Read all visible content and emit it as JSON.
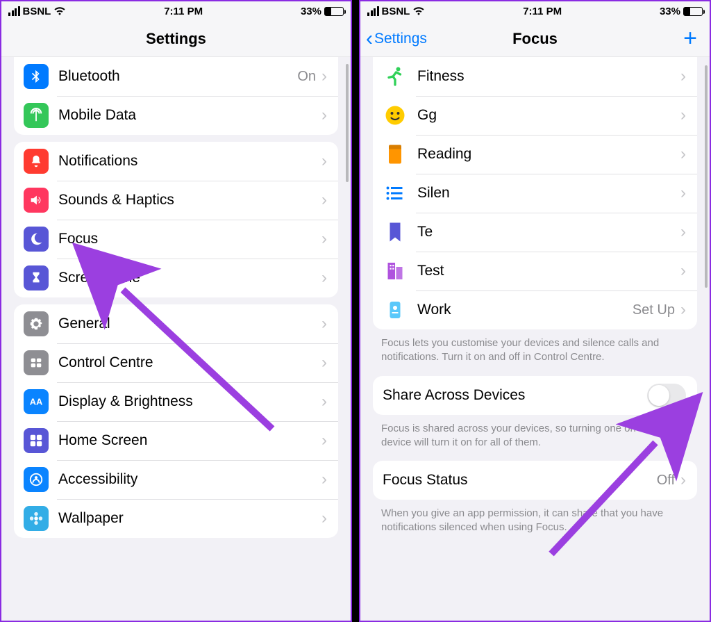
{
  "status": {
    "carrier": "BSNL",
    "time": "7:11 PM",
    "battery": "33%"
  },
  "left": {
    "title": "Settings",
    "groups": [
      {
        "cutTop": true,
        "rows": [
          {
            "id": "bluetooth",
            "label": "Bluetooth",
            "value": "On",
            "iconBg": "bg-blue",
            "iconShape": "bluetooth"
          },
          {
            "id": "mobile-data",
            "label": "Mobile Data",
            "iconBg": "bg-green",
            "iconShape": "antenna"
          }
        ]
      },
      {
        "rows": [
          {
            "id": "notifications",
            "label": "Notifications",
            "iconBg": "bg-red",
            "iconShape": "bell"
          },
          {
            "id": "sounds-haptics",
            "label": "Sounds & Haptics",
            "iconBg": "bg-pink",
            "iconShape": "speaker"
          },
          {
            "id": "focus",
            "label": "Focus",
            "iconBg": "bg-indigo",
            "iconShape": "moon"
          },
          {
            "id": "screen-time",
            "label": "Screen Time",
            "iconBg": "bg-indigo",
            "iconShape": "hourglass"
          }
        ]
      },
      {
        "rows": [
          {
            "id": "general",
            "label": "General",
            "iconBg": "bg-grey",
            "iconShape": "gear"
          },
          {
            "id": "control-centre",
            "label": "Control Centre",
            "iconBg": "bg-grey",
            "iconShape": "sliders"
          },
          {
            "id": "display-brightness",
            "label": "Display & Brightness",
            "iconBg": "bg-bluea",
            "iconShape": "aa"
          },
          {
            "id": "home-screen",
            "label": "Home Screen",
            "iconBg": "bg-indigo",
            "iconShape": "grid"
          },
          {
            "id": "accessibility",
            "label": "Accessibility",
            "iconBg": "bg-bluea",
            "iconShape": "person"
          },
          {
            "id": "wallpaper",
            "label": "Wallpaper",
            "iconBg": "bg-teal",
            "iconShape": "flower"
          }
        ]
      }
    ]
  },
  "right": {
    "back": "Settings",
    "title": "Focus",
    "list": [
      {
        "id": "fitness",
        "label": "Fitness",
        "iconColor": "#30d158",
        "iconShape": "runner"
      },
      {
        "id": "gg",
        "label": "Gg",
        "iconColor": "#ffcc00",
        "iconShape": "smile"
      },
      {
        "id": "reading",
        "label": "Reading",
        "iconColor": "#ff9500",
        "iconShape": "book"
      },
      {
        "id": "silen",
        "label": "Silen",
        "iconColor": "#007aff",
        "iconShape": "list"
      },
      {
        "id": "te",
        "label": "Te",
        "iconColor": "#5856d6",
        "iconShape": "bookmark"
      },
      {
        "id": "test",
        "label": "Test",
        "iconColor": "#af52de",
        "iconShape": "building"
      },
      {
        "id": "work",
        "label": "Work",
        "value": "Set Up",
        "iconColor": "#5ac8fa",
        "iconShape": "badge"
      }
    ],
    "footer1": "Focus lets you customise your devices and silence calls and notifications. Turn it on and off in Control Centre.",
    "share": {
      "label": "Share Across Devices",
      "on": false
    },
    "footer2": "Focus is shared across your devices, so turning one on for this device will turn it on for all of them.",
    "status": {
      "label": "Focus Status",
      "value": "Off"
    },
    "footer3": "When you give an app permission, it can share that you have notifications silenced when using Focus."
  },
  "colors": {
    "arrow": "#9b3fe0"
  }
}
